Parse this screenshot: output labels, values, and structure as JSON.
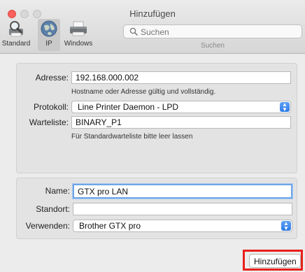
{
  "window": {
    "title": "Hinzufügen"
  },
  "toolbar": {
    "items": [
      {
        "label": "Standard",
        "icon": "magnifier-printer-icon"
      },
      {
        "label": "IP",
        "icon": "globe-icon",
        "selected": true
      },
      {
        "label": "Windows",
        "icon": "printer-icon"
      }
    ],
    "search": {
      "placeholder": "Suchen",
      "caption": "Suchen"
    }
  },
  "connection": {
    "address_label": "Adresse:",
    "address_value": "192.168.000.002",
    "address_hint": "Hostname oder Adresse gültig und vollständig.",
    "protocol_label": "Protokoll:",
    "protocol_value": "Line Printer Daemon - LPD",
    "queue_label": "Warteliste:",
    "queue_value": "BINARY_P1",
    "queue_hint": "Für Standardwarteliste bitte leer lassen"
  },
  "printer": {
    "name_label": "Name:",
    "name_value": "GTX pro LAN",
    "location_label": "Standort:",
    "location_value": "",
    "use_label": "Verwenden:",
    "use_value": "Brother GTX pro"
  },
  "actions": {
    "add_label": "Hinzufügen"
  },
  "colors": {
    "highlight": "#e8201c",
    "focus": "#6ea6e6",
    "accent": "#2f7ae5"
  }
}
